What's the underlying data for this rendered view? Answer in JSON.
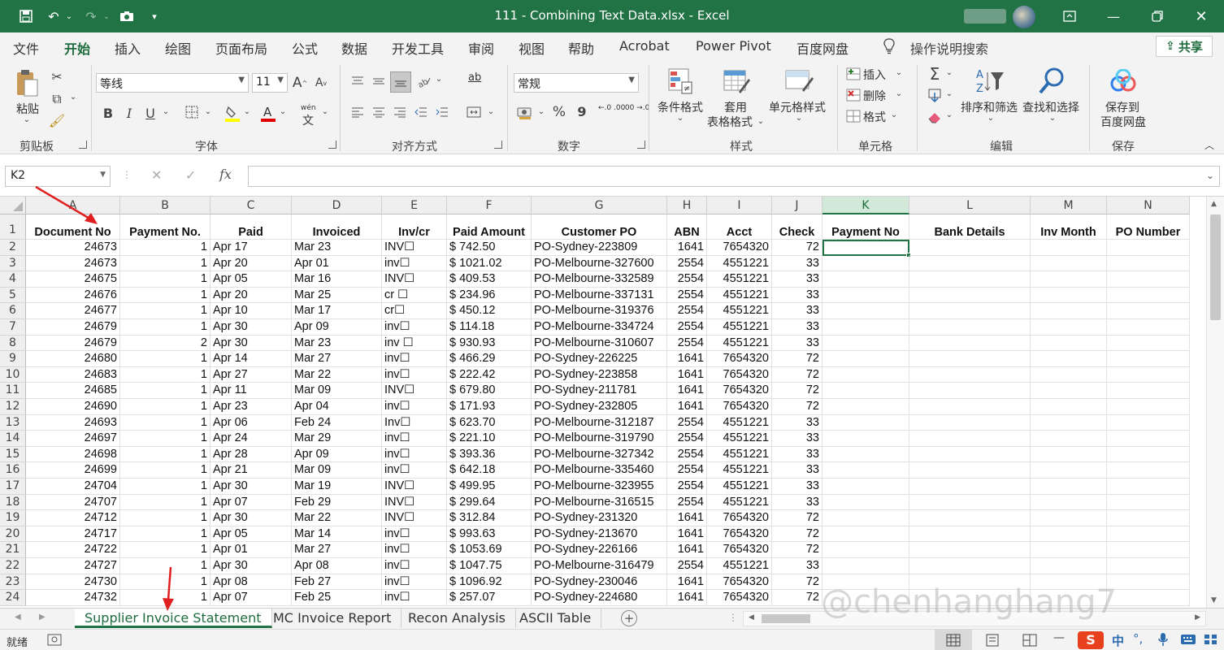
{
  "window": {
    "title": "111 - Combining Text Data.xlsx  -  Excel"
  },
  "menu": {
    "tabs": [
      "文件",
      "开始",
      "插入",
      "绘图",
      "页面布局",
      "公式",
      "数据",
      "开发工具",
      "审阅",
      "视图",
      "帮助",
      "Acrobat",
      "Power Pivot",
      "百度网盘"
    ],
    "active_index": 1,
    "tell_me": "操作说明搜索",
    "share": "共享"
  },
  "ribbon": {
    "clipboard": {
      "label": "剪贴板",
      "paste": "粘贴"
    },
    "font": {
      "label": "字体",
      "font_name": "等线",
      "font_size": "11",
      "grow": "A",
      "shrink": "A",
      "bold": "B",
      "italic": "I",
      "underline": "U",
      "phonetic_top": "wén",
      "phonetic_bottom": "文"
    },
    "alignment": {
      "label": "对齐方式",
      "wrap": "ab"
    },
    "number": {
      "label": "数字",
      "format": "常规",
      "percent": "%",
      "comma": "9",
      "inc_decimal": "←.0 .00",
      "dec_decimal": ".00 →.0"
    },
    "styles": {
      "label": "样式",
      "conditional": "条件格式",
      "table_top": "套用",
      "table_bottom": "表格格式",
      "cell_styles": "单元格样式"
    },
    "cells": {
      "label": "单元格",
      "insert": "插入",
      "delete": "删除",
      "format": "格式"
    },
    "editing": {
      "label": "编辑",
      "sort_filter": "排序和筛选",
      "find_select": "查找和选择"
    },
    "save": {
      "label": "保存",
      "top": "保存到",
      "bottom": "百度网盘"
    }
  },
  "formula_bar": {
    "name_box": "K2",
    "fx": "fx",
    "cancel": "✕",
    "confirm": "✓",
    "formula": ""
  },
  "grid": {
    "columns": [
      "A",
      "B",
      "C",
      "D",
      "E",
      "F",
      "G",
      "H",
      "I",
      "J",
      "K",
      "L",
      "M",
      "N"
    ],
    "selected_column": "K",
    "headers": [
      "Document No",
      "Payment No.",
      "Paid",
      "Invoiced",
      "Inv/cr",
      "Paid Amount",
      "Customer PO",
      "ABN",
      "Acct",
      "Check",
      "Payment No",
      "Bank Details",
      "Inv Month",
      "PO Number"
    ],
    "row_numbers": [
      "1",
      "2",
      "3",
      "4",
      "5",
      "6",
      "7",
      "8",
      "9",
      "10",
      "11",
      "12",
      "13",
      "14",
      "15",
      "16",
      "17",
      "18",
      "19",
      "20",
      "21",
      "22",
      "23",
      "24"
    ],
    "rows": [
      [
        "24673",
        "1",
        "Apr 17",
        "Mar 23",
        "INV☐",
        "$ 742.50",
        "PO-Sydney-223809",
        "1641",
        "7654320",
        "72"
      ],
      [
        "24673",
        "1",
        "Apr 20",
        "Apr 01",
        "inv☐",
        "$ 1021.02",
        "PO-Melbourne-327600",
        "2554",
        "4551221",
        "33"
      ],
      [
        "24675",
        "1",
        "Apr 05",
        "Mar 16",
        "INV☐",
        "$ 409.53",
        "PO-Melbourne-332589",
        "2554",
        "4551221",
        "33"
      ],
      [
        "24676",
        "1",
        "Apr 20",
        "Mar 25",
        "cr ☐",
        "$ 234.96",
        "PO-Melbourne-337131",
        "2554",
        "4551221",
        "33"
      ],
      [
        "24677",
        "1",
        "Apr 10",
        "Mar 17",
        "cr☐",
        "$ 450.12",
        "PO-Melbourne-319376",
        "2554",
        "4551221",
        "33"
      ],
      [
        "24679",
        "1",
        "Apr 30",
        "Apr 09",
        "inv☐",
        "$ 114.18",
        "PO-Melbourne-334724",
        "2554",
        "4551221",
        "33"
      ],
      [
        "24679",
        "2",
        "Apr 30",
        "Mar 23",
        "inv  ☐",
        "$ 930.93",
        "PO-Melbourne-310607",
        "2554",
        "4551221",
        "33"
      ],
      [
        "24680",
        "1",
        "Apr 14",
        "Mar 27",
        "  inv☐",
        "$ 466.29",
        "PO-Sydney-226225",
        "1641",
        "7654320",
        "72"
      ],
      [
        "24683",
        "1",
        "Apr 27",
        "Mar 22",
        "inv☐",
        "$ 222.42",
        "PO-Sydney-223858",
        "1641",
        "7654320",
        "72"
      ],
      [
        "24685",
        "1",
        "Apr 11",
        "Mar 09",
        "INV☐",
        "$ 679.80",
        "PO-Sydney-211781",
        "1641",
        "7654320",
        "72"
      ],
      [
        "24690",
        "1",
        "Apr 23",
        "Apr 04",
        "inv☐",
        "$ 171.93",
        "PO-Sydney-232805",
        "1641",
        "7654320",
        "72"
      ],
      [
        "24693",
        "1",
        "Apr 06",
        "Feb 24",
        "Inv☐",
        "$ 623.70",
        "PO-Melbourne-312187",
        "2554",
        "4551221",
        "33"
      ],
      [
        "24697",
        "1",
        "Apr 24",
        "Mar 29",
        "inv☐",
        "$ 221.10",
        "PO-Melbourne-319790",
        "2554",
        "4551221",
        "33"
      ],
      [
        "24698",
        "1",
        "Apr 28",
        "Apr 09",
        "inv☐",
        "$ 393.36",
        "PO-Melbourne-327342",
        "2554",
        "4551221",
        "33"
      ],
      [
        "24699",
        "1",
        "Apr 21",
        "Mar 09",
        "inv☐",
        "$ 642.18",
        "PO-Melbourne-335460",
        "2554",
        "4551221",
        "33"
      ],
      [
        "24704",
        "1",
        "Apr 30",
        "Mar 19",
        "INV☐",
        "$ 499.95",
        "PO-Melbourne-323955",
        "2554",
        "4551221",
        "33"
      ],
      [
        "24707",
        "1",
        "Apr 07",
        "Feb 29",
        "INV☐",
        "$ 299.64",
        "PO-Melbourne-316515",
        "2554",
        "4551221",
        "33"
      ],
      [
        "24712",
        "1",
        "Apr 30",
        "Mar 22",
        "INV☐",
        "$ 312.84",
        "PO-Sydney-231320",
        "1641",
        "7654320",
        "72"
      ],
      [
        "24717",
        "1",
        "Apr 05",
        "Mar 14",
        "inv☐",
        "$ 993.63",
        "PO-Sydney-213670",
        "1641",
        "7654320",
        "72"
      ],
      [
        "24722",
        "1",
        "Apr 01",
        "Mar 27",
        "inv☐",
        "$ 1053.69",
        "PO-Sydney-226166",
        "1641",
        "7654320",
        "72"
      ],
      [
        "24727",
        "1",
        "Apr 30",
        "Apr 08",
        "inv☐",
        "$ 1047.75",
        "PO-Melbourne-316479",
        "2554",
        "4551221",
        "33"
      ],
      [
        "24730",
        "1",
        "Apr 08",
        "Feb 27",
        "inv☐",
        "$ 1096.92",
        "PO-Sydney-230046",
        "1641",
        "7654320",
        "72"
      ],
      [
        "24732",
        "1",
        "Apr 07",
        "Feb 25",
        "inv☐",
        "$ 257.07",
        "PO-Sydney-224680",
        "1641",
        "7654320",
        "72"
      ]
    ]
  },
  "sheets": {
    "tabs": [
      "Supplier Invoice Statement",
      "MC Invoice Report",
      "Recon Analysis",
      "ASCII Table"
    ],
    "active_index": 0
  },
  "status": {
    "ready": "就绪",
    "ime": "中"
  },
  "watermark": "@chenhanghang7",
  "colors": {
    "excel_green": "#217346",
    "arrow_red": "#e02020"
  }
}
